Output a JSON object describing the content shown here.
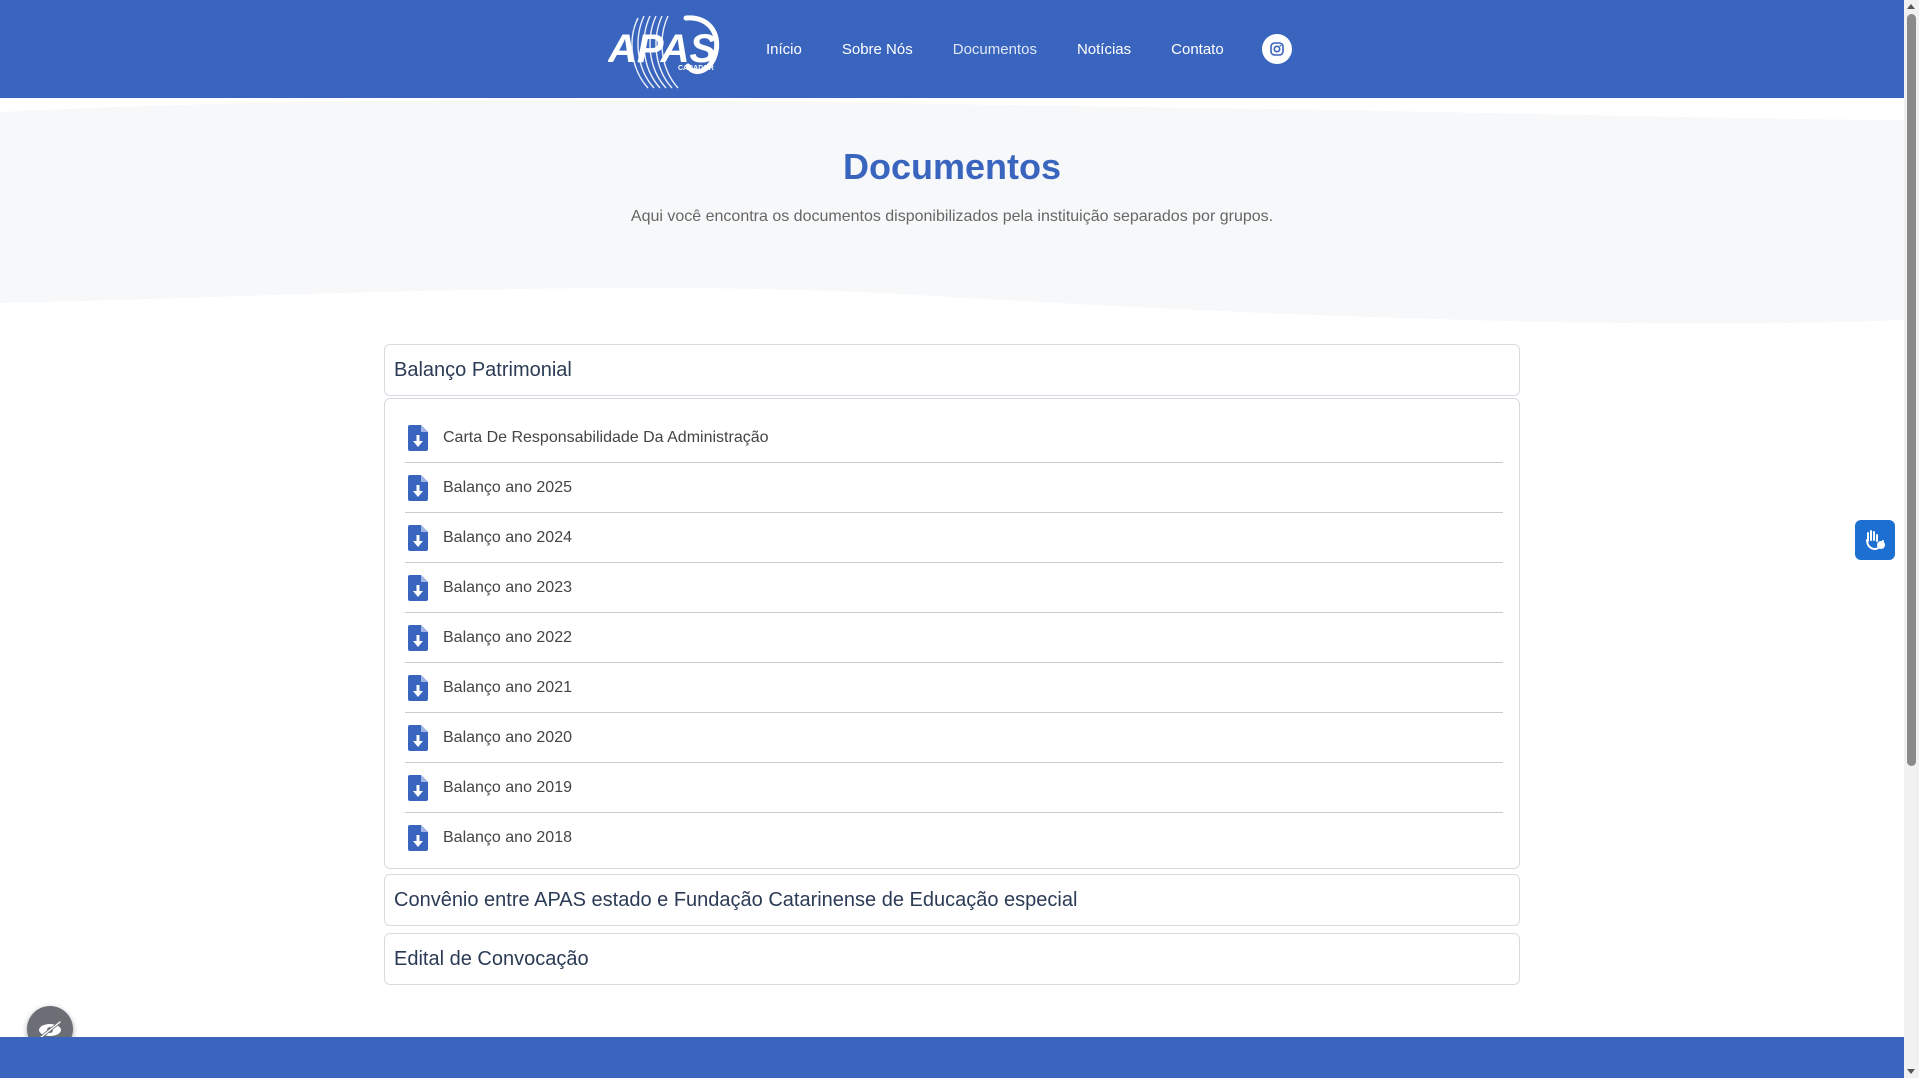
{
  "header": {
    "logo_text": "APAS",
    "logo_subtext": "CAÇADOR",
    "nav": [
      {
        "label": "Início",
        "active": false
      },
      {
        "label": "Sobre Nós",
        "active": false
      },
      {
        "label": "Documentos",
        "active": true
      },
      {
        "label": "Notícias",
        "active": false
      },
      {
        "label": "Contato",
        "active": false
      }
    ],
    "social_icon": "instagram-icon"
  },
  "hero": {
    "title": "Documentos",
    "subtitle": "Aqui você encontra os documentos disponibilizados pela instituição separados por grupos."
  },
  "sections": [
    {
      "title": "Balanço Patrimonial",
      "expanded": true,
      "documents": [
        "Carta De Responsabilidade Da Administração",
        "Balanço ano 2025",
        "Balanço ano 2024",
        "Balanço ano 2023",
        "Balanço ano 2022",
        "Balanço ano 2021",
        "Balanço ano 2020",
        "Balanço ano 2019",
        "Balanço ano 2018"
      ]
    },
    {
      "title": "Convênio entre APAS estado e Fundação Catarinense de Educação especial",
      "expanded": false
    },
    {
      "title": "Edital de Convocação",
      "expanded": false
    }
  ],
  "document_icon": "file-download-icon",
  "widgets": {
    "sign_language_icon": "hand-sign-icon",
    "accessibility_icon": "accessibility-toggle-icon"
  },
  "colors": {
    "brand_blue": "#3a65be",
    "title_blue": "#3a65be",
    "hero_bg": "#f7f8f9",
    "border": "#d7dbe0",
    "vlibras_blue": "#1d6fd1"
  }
}
